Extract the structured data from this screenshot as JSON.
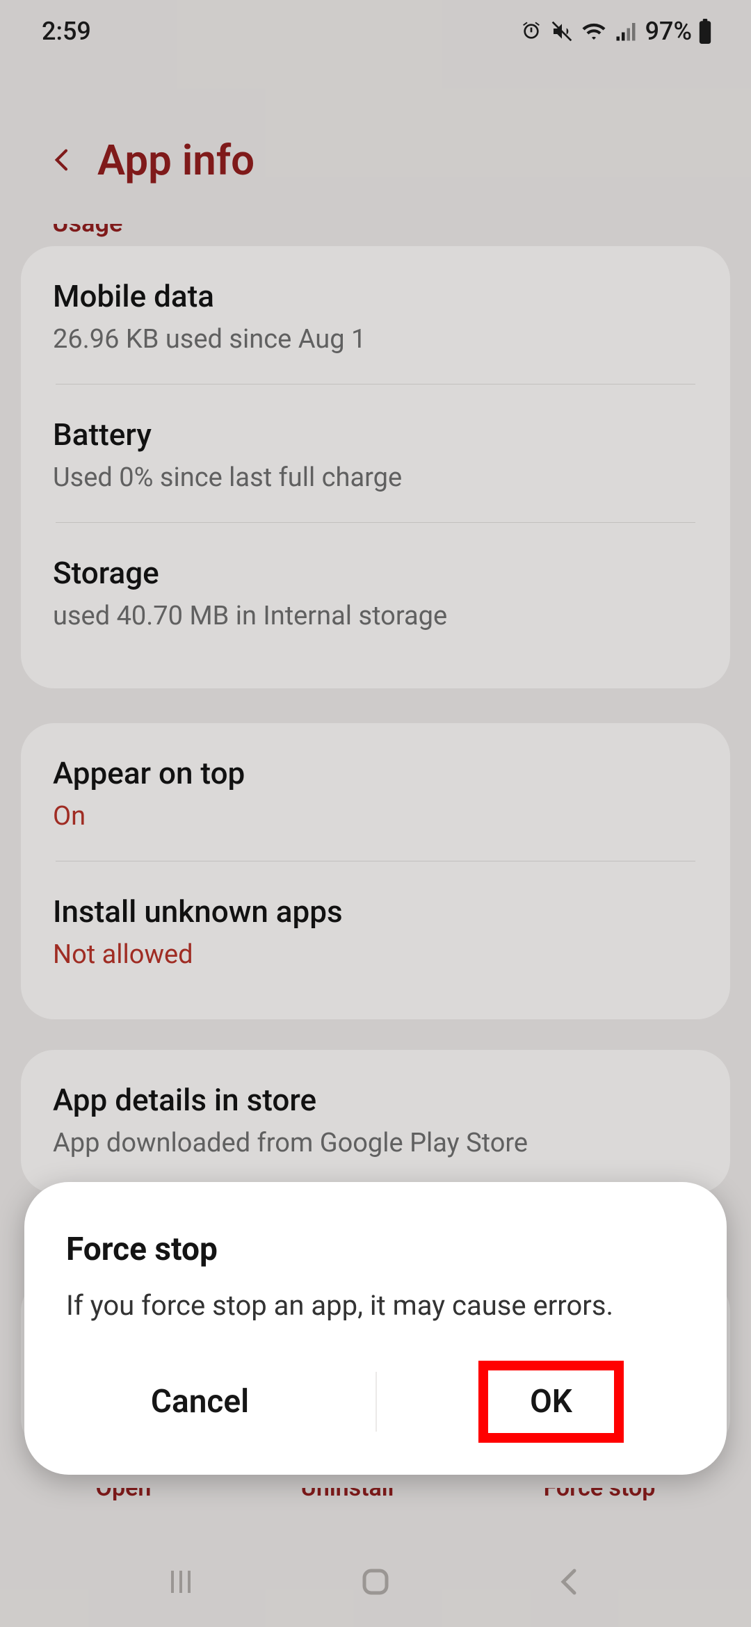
{
  "status": {
    "time": "2:59",
    "battery_pct": "97%"
  },
  "header": {
    "title": "App info"
  },
  "cut_section_label": "Usage",
  "usage_card": {
    "mobile_data": {
      "title": "Mobile data",
      "sub": "26.96 KB used since Aug 1"
    },
    "battery": {
      "title": "Battery",
      "sub": "Used 0% since last full charge"
    },
    "storage": {
      "title": "Storage",
      "sub": "used 40.70 MB in Internal storage"
    }
  },
  "perm_card": {
    "appear_on_top": {
      "title": "Appear on top",
      "sub": "On"
    },
    "install_unknown_apps": {
      "title": "Install unknown apps",
      "sub": "Not allowed"
    }
  },
  "store_card": {
    "title": "App details in store",
    "sub": "App downloaded from Google Play Store"
  },
  "bottom_actions": {
    "open": "Open",
    "uninstall": "Uninstall",
    "force_stop": "Force stop"
  },
  "dialog": {
    "title": "Force stop",
    "body": "If you force stop an app, it may cause errors.",
    "cancel": "Cancel",
    "ok": "OK"
  }
}
